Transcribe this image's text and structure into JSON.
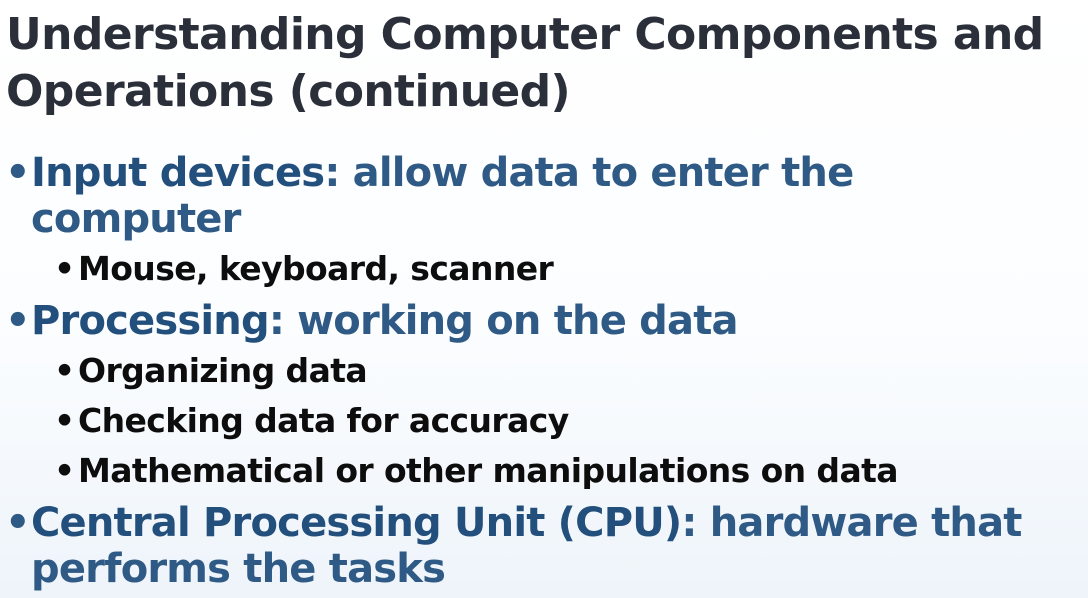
{
  "slide": {
    "title_line1": "Understanding Computer Components and",
    "title_line2": "Operations (continued)",
    "bullet_glyph": "•",
    "bullets": [
      {
        "term": "Input devices",
        "rest_line1": ": allow data to enter the",
        "rest_line2": "computer",
        "sub": [
          "Mouse, keyboard, scanner"
        ]
      },
      {
        "term": "Processing",
        "rest_line1": ": working on the data",
        "sub": [
          "Organizing data",
          "Checking data for accuracy",
          "Mathematical or other manipulations on data"
        ]
      },
      {
        "term": "Central Processing Unit (CPU)",
        "rest_line1": ": hardware that",
        "rest_line2": "performs the tasks",
        "sub": []
      }
    ]
  },
  "colors": {
    "title": "#2b2f3a",
    "level1": "#2e5a85",
    "level2": "#0d0d0d"
  }
}
